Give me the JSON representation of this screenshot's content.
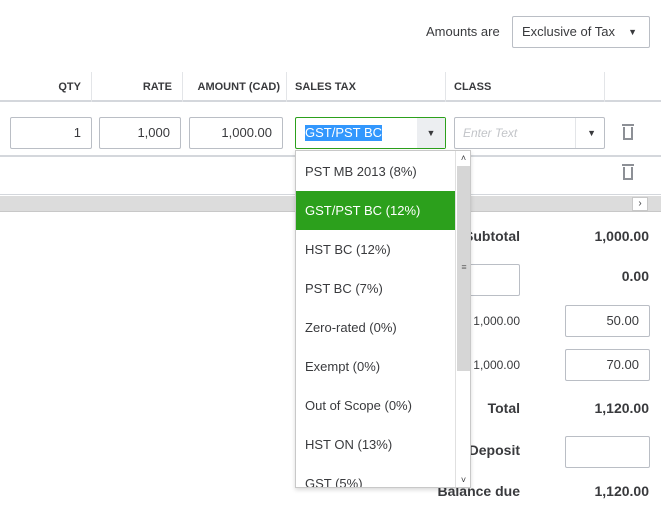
{
  "amounts": {
    "label": "Amounts are",
    "selected": "Exclusive of Tax"
  },
  "columns": [
    "QTY",
    "RATE",
    "AMOUNT (CAD)",
    "SALES TAX",
    "CLASS"
  ],
  "row1": {
    "qty": "1",
    "rate": "1,000",
    "amount": "1,000.00",
    "sales_tax": "GST/PST BC",
    "class_placeholder": "Enter Text"
  },
  "dropdown": [
    "PST MB 2013 (8%)",
    "GST/PST BC (12%)",
    "HST BC (12%)",
    "PST BC (7%)",
    "Zero-rated (0%)",
    "Exempt (0%)",
    "Out of Scope (0%)",
    "HST ON (13%)",
    "GST (5%)"
  ],
  "summary": {
    "subtotal_label": "Subtotal",
    "subtotal": "1,000.00",
    "discount": "0.00",
    "tax1_base": "1,000.00",
    "tax1": "50.00",
    "tax2_base": "1,000.00",
    "tax2": "70.00",
    "total_label": "Total",
    "total": "1,120.00",
    "deposit_label": "Deposit",
    "deposit": "",
    "balance_label": "Balance due",
    "balance": "1,120.00"
  }
}
